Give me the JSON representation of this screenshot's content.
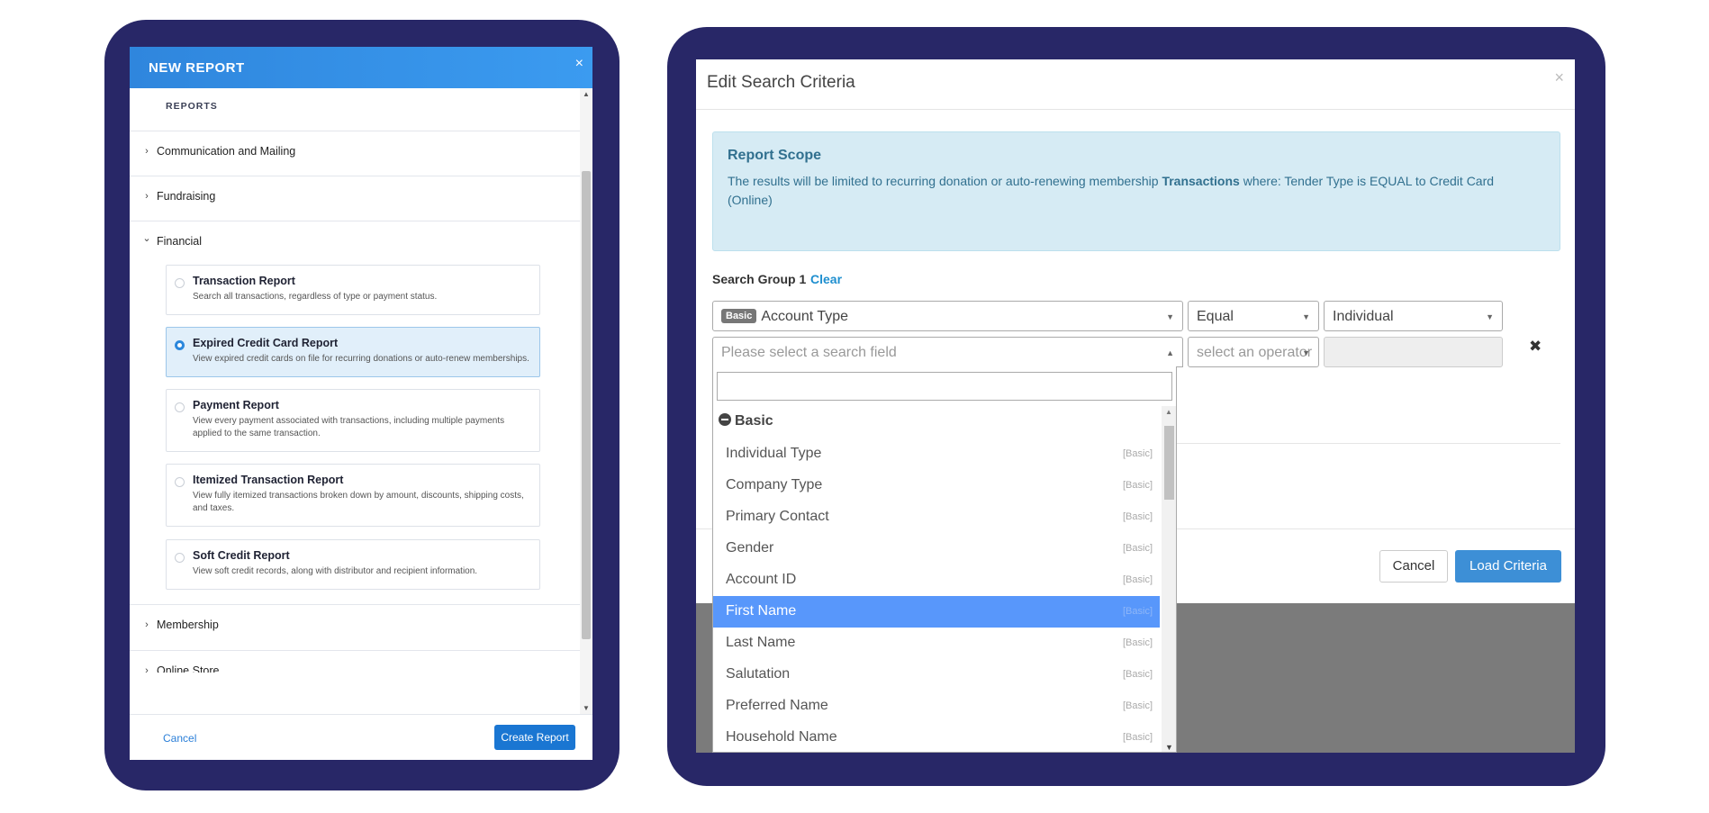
{
  "new_report": {
    "title": "NEW REPORT",
    "close": "×",
    "section_label": "REPORTS",
    "categories": [
      {
        "label": "Communication and Mailing",
        "chevron": "›"
      },
      {
        "label": "Fundraising",
        "chevron": "›"
      },
      {
        "label": "Financial",
        "chevron": "⌄"
      },
      {
        "label": "Membership",
        "chevron": "›"
      },
      {
        "label": "Online Store",
        "chevron": "›"
      }
    ],
    "reports": [
      {
        "title": "Transaction Report",
        "desc": "Search all transactions, regardless of type or payment status."
      },
      {
        "title": "Expired Credit Card Report",
        "desc": "View expired credit cards on file for recurring donations or auto-renew memberships."
      },
      {
        "title": "Payment Report",
        "desc": "View every payment associated with transactions, including multiple payments applied to the same transaction."
      },
      {
        "title": "Itemized Transaction Report",
        "desc": "View fully itemized transactions broken down by amount, discounts, shipping costs, and taxes."
      },
      {
        "title": "Soft Credit Report",
        "desc": "View soft credit records, along with distributor and recipient information."
      }
    ],
    "selected_report": "Expired Credit Card Report",
    "cancel_label": "Cancel",
    "create_label": "Create Report"
  },
  "edit_search": {
    "title": "Edit Search Criteria",
    "close": "×",
    "scope": {
      "title": "Report Scope",
      "text_before": "The results will be limited to recurring donation or auto-renewing membership ",
      "text_bold": "Transactions",
      "text_after": " where: Tender Type is EQUAL to Credit Card (Online)"
    },
    "group": {
      "label": "Search Group 1",
      "clear": "Clear"
    },
    "row1": {
      "badge": "Basic",
      "field": "Account Type",
      "operator": "Equal",
      "value": "Individual"
    },
    "row2": {
      "field_placeholder": "Please select a search field",
      "operator_placeholder": "select an operator"
    },
    "remove": "✖",
    "cancel_label": "Cancel",
    "load_label": "Load Criteria",
    "dropdown": {
      "group": "Basic",
      "items": [
        {
          "name": "Individual Type",
          "tag": "[Basic]"
        },
        {
          "name": "Company Type",
          "tag": "[Basic]"
        },
        {
          "name": "Primary Contact",
          "tag": "[Basic]"
        },
        {
          "name": "Gender",
          "tag": "[Basic]"
        },
        {
          "name": "Account ID",
          "tag": "[Basic]"
        },
        {
          "name": "First Name",
          "tag": "[Basic]"
        },
        {
          "name": "Last Name",
          "tag": "[Basic]"
        },
        {
          "name": "Salutation",
          "tag": "[Basic]"
        },
        {
          "name": "Preferred Name",
          "tag": "[Basic]"
        },
        {
          "name": "Household Name",
          "tag": "[Basic]"
        }
      ],
      "highlighted": "First Name"
    }
  },
  "colors": {
    "frame": "#282767",
    "header_blue": "#2f86dd",
    "selected_card": "#e1effa",
    "scope_bg": "#d6ebf4",
    "highlight": "#5897fb",
    "load_button": "#3d8fd6"
  }
}
